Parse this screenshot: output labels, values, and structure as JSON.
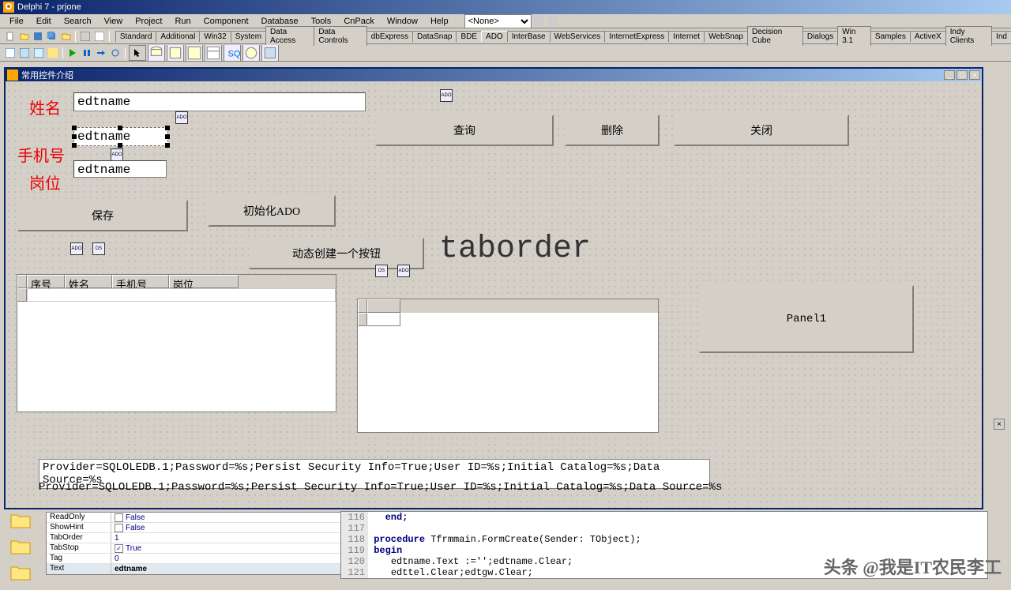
{
  "app": {
    "title": "Delphi 7 - prjone"
  },
  "menu": {
    "items": [
      "File",
      "Edit",
      "Search",
      "View",
      "Project",
      "Run",
      "Component",
      "Database",
      "Tools",
      "CnPack",
      "Window",
      "Help"
    ],
    "dropdown": "<None>"
  },
  "palette": {
    "tabs": [
      "Standard",
      "Additional",
      "Win32",
      "System",
      "Data Access",
      "Data Controls",
      "dbExpress",
      "DataSnap",
      "BDE",
      "ADO",
      "InterBase",
      "WebServices",
      "InternetExpress",
      "Internet",
      "WebSnap",
      "Decision Cube",
      "Dialogs",
      "Win 3.1",
      "Samples",
      "ActiveX",
      "Indy Clients",
      "Ind"
    ],
    "active": "ADO"
  },
  "form": {
    "title": "常用控件介绍"
  },
  "labels": {
    "name": "姓名",
    "phone": "手机号",
    "post": "岗位",
    "taborder": "taborder"
  },
  "edits": {
    "e1": "edtname",
    "e2": "edtname",
    "e3": "edtname"
  },
  "buttons": {
    "query": "查询",
    "delete": "删除",
    "close": "关闭",
    "save": "保存",
    "initado": "初始化ADO",
    "dynbtn": "动态创建一个按钮"
  },
  "panel1": "Panel1",
  "grid": {
    "cols": [
      "序号",
      "姓名",
      "手机号",
      "岗位"
    ]
  },
  "conn": {
    "edit": "Provider=SQLOLEDB.1;Password=%s;Persist Security Info=True;User ID=%s;Initial Catalog=%s;Data Source=%s",
    "label": "Provider=SQLOLEDB.1;Password=%s;Persist Security Info=True;User ID=%s;Initial Catalog=%s;Data Source=%s"
  },
  "inspector": {
    "rows": [
      {
        "name": "ReadOnly",
        "val": "False",
        "chk": ""
      },
      {
        "name": "ShowHint",
        "val": "False",
        "chk": ""
      },
      {
        "name": "TabOrder",
        "val": "1"
      },
      {
        "name": "TabStop",
        "val": "True",
        "chk": "✓"
      },
      {
        "name": "Tag",
        "val": "0"
      },
      {
        "name": "Text",
        "val": "edtname",
        "bold": true
      }
    ]
  },
  "code": {
    "lines": [
      {
        "n": "116",
        "t": "end;",
        "kw": true,
        "ind": 1
      },
      {
        "n": "117",
        "t": ""
      },
      {
        "n": "118",
        "pre": "procedure ",
        "mid": "Tfrmmain.FormCreate(Sender: TObject);"
      },
      {
        "n": "119",
        "t": "begin",
        "kw": true
      },
      {
        "n": "120",
        "t": "edtname.Text :='';edtname.Clear;",
        "ind": 2
      },
      {
        "n": "121",
        "t": "edttel.Clear;edtgw.Clear;",
        "ind": 2
      }
    ]
  },
  "watermark": "头条 @我是IT农民李工"
}
